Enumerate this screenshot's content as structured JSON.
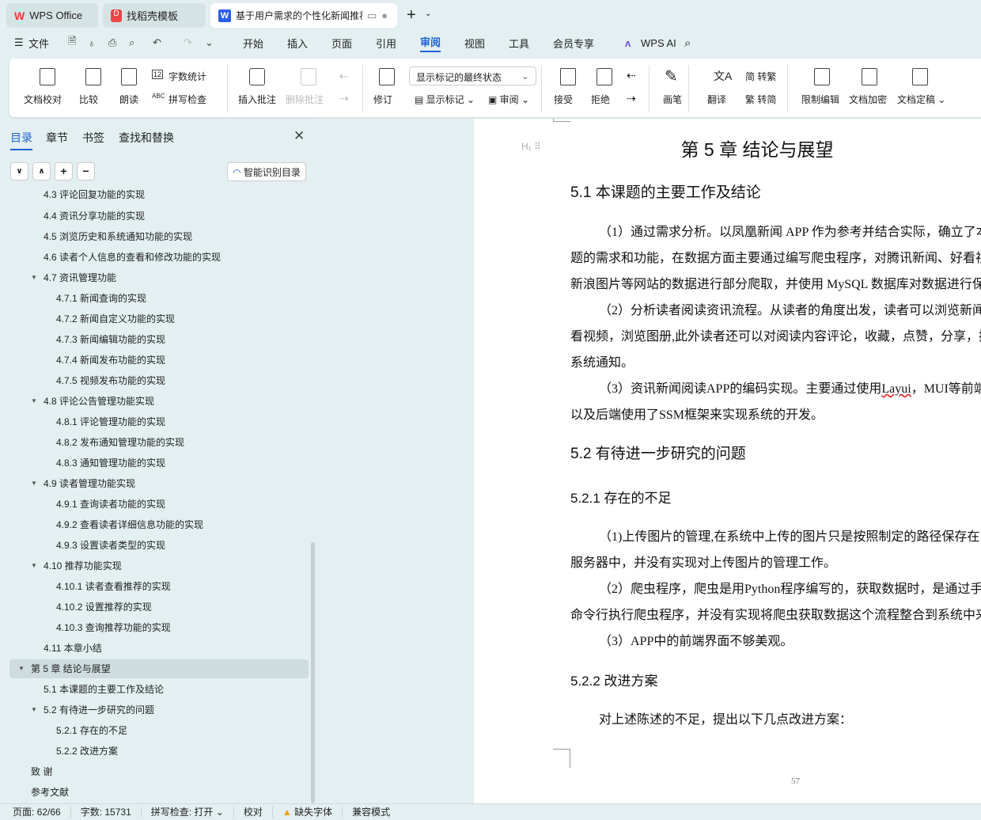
{
  "tabs": [
    {
      "label": "WPS Office",
      "icon": "wps-logo-icon"
    },
    {
      "label": "找稻壳模板",
      "icon": "docer-icon"
    },
    {
      "label": "基于用户需求的个性化新闻推荐",
      "icon": "writer-icon"
    }
  ],
  "menu": {
    "file": "文件",
    "items": [
      "开始",
      "插入",
      "页面",
      "引用",
      "审阅",
      "视图",
      "工具",
      "会员专享"
    ],
    "active": "审阅",
    "ai": "WPS AI"
  },
  "ribbon": {
    "proofread": "文档校对",
    "compare": "比较",
    "read_aloud": "朗读",
    "word_count": "字数统计",
    "spell_check": "拼写检查",
    "insert_comment": "插入批注",
    "delete_comment": "删除批注",
    "revise": "修订",
    "markup_state": "显示标记的最终状态",
    "show_markup": "显示标记",
    "review": "审阅",
    "accept": "接受",
    "reject": "拒绝",
    "pen": "画笔",
    "translate": "翻译",
    "to_trad": "转繁",
    "to_simp": "转简",
    "restrict": "限制编辑",
    "encrypt": "文档加密",
    "finalize": "文档定稿"
  },
  "nav": {
    "tabs": [
      "目录",
      "章节",
      "书签",
      "查找和替换"
    ],
    "active": "目录",
    "smart_toc": "智能识别目录",
    "toc": [
      {
        "t": "4.3 评论回复功能的实现",
        "l": 2
      },
      {
        "t": "4.4 资讯分享功能的实现",
        "l": 2
      },
      {
        "t": "4.5 浏览历史和系统通知功能的实现",
        "l": 2
      },
      {
        "t": "4.6 读者个人信息的查看和修改功能的实现",
        "l": 2
      },
      {
        "t": "4.7 资讯管理功能",
        "l": 2,
        "exp": true
      },
      {
        "t": "4.7.1 新闻查询的实现",
        "l": 3
      },
      {
        "t": "4.7.2 新闻自定义功能的实现",
        "l": 3
      },
      {
        "t": "4.7.3 新闻编辑功能的实现",
        "l": 3
      },
      {
        "t": "4.7.4 新闻发布功能的实现",
        "l": 3
      },
      {
        "t": "4.7.5 视频发布功能的实现",
        "l": 3
      },
      {
        "t": "4.8 评论公告管理功能实现",
        "l": 2,
        "exp": true
      },
      {
        "t": "4.8.1 评论管理功能的实现",
        "l": 3
      },
      {
        "t": "4.8.2 发布通知管理功能的实现",
        "l": 3
      },
      {
        "t": "4.8.3 通知管理功能的实现",
        "l": 3
      },
      {
        "t": "4.9 读者管理功能实现",
        "l": 2,
        "exp": true
      },
      {
        "t": "4.9.1 查询读者功能的实现",
        "l": 3
      },
      {
        "t": "4.9.2 查看读者详细信息功能的实现",
        "l": 3
      },
      {
        "t": "4.9.3 设置读者类型的实现",
        "l": 3
      },
      {
        "t": "4.10 推荐功能实现",
        "l": 2,
        "exp": true
      },
      {
        "t": "4.10.1 读者查看推荐的实现",
        "l": 3
      },
      {
        "t": "4.10.2 设置推荐的实现",
        "l": 3
      },
      {
        "t": "4.10.3 查询推荐功能的实现",
        "l": 3
      },
      {
        "t": "4.11 本章小结",
        "l": 2
      },
      {
        "t": "第 5 章  结论与展望",
        "l": 1,
        "exp": true,
        "sel": true
      },
      {
        "t": "5.1  本课题的主要工作及结论",
        "l": 2
      },
      {
        "t": "5.2  有待进一步研究的问题",
        "l": 2,
        "exp": true
      },
      {
        "t": "5.2.1  存在的不足",
        "l": 3
      },
      {
        "t": "5.2.2  改进方案",
        "l": 3
      },
      {
        "t": "致    谢",
        "l": 1
      },
      {
        "t": "参考文献",
        "l": 1
      }
    ]
  },
  "doc": {
    "chapter": "第 5 章  结论与展望",
    "h51": "5.1  本课题的主要工作及结论",
    "p1": [
      "（1）通过需求分析。以凤凰新闻 APP 作为参考并结合实际，确立了本课",
      "题的需求和功能，在数据方面主要通过编写爬虫程序，对腾讯新闻、好看视频、",
      "新浪图片等网站的数据进行部分爬取，并使用 MySQL 数据库对数据进行保存。",
      "（2）分析读者阅读资讯流程。从读者的角度出发，读者可以浏览新闻，",
      "看视频，浏览图册,此外读者还可以对阅读内容评论，收藏，点赞，分享，接收",
      "系统通知。"
    ],
    "p3a": "（3）资讯新闻阅读APP的编码实现。主要通过使用",
    "p3b": "Layui",
    "p3c": "，MUI等前端技术",
    "p3d": "以及后端使用了SSM框架来实现系统的开发。",
    "h52": "5.2  有待进一步研究的问题",
    "h521": "5.2.1  存在的不足",
    "p4": [
      "（1)上传图片的管理,在系统中上传的图片只是按照制定的路径保存在",
      "服务器中，并没有实现对上传图片的管理工作。",
      "（2）爬虫程序，爬虫是用Python程序编写的，获取数据时，是通过手动",
      "命令行执行爬虫程序，并没有实现将爬虫获取数据这个流程整合到系统中来",
      "（3）APP中的前端界面不够美观。"
    ],
    "h522": "5.2.2  改进方案",
    "p5": "对上述陈述的不足，提出以下几点改进方案：",
    "page_num": "57"
  },
  "status": {
    "page": "页面: 62/66",
    "words": "字数: 15731",
    "spell": "拼写检查: 打开",
    "proof": "校对",
    "missing_font": "缺失字体",
    "compat": "兼容模式"
  },
  "colors": {
    "accent": "#1f63d8",
    "background": "#e3eff0"
  }
}
